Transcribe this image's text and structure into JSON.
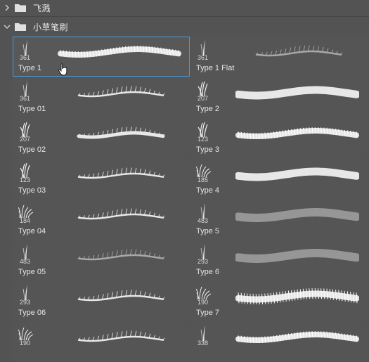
{
  "groups": [
    {
      "label": "飞溅",
      "expanded": false
    },
    {
      "label": "小草笔刷",
      "expanded": true
    }
  ],
  "brushes": [
    {
      "size": "361",
      "name": "Type 1",
      "stroke": "band",
      "tip": "blade",
      "selected": true
    },
    {
      "size": "361",
      "name": "Type 1 Flat",
      "stroke": "faint",
      "tip": "blade",
      "selected": false
    },
    {
      "size": "361",
      "name": "Type 01",
      "stroke": "spiky",
      "tip": "blade",
      "selected": false
    },
    {
      "size": "207",
      "name": "Type 2",
      "stroke": "thick",
      "tip": "tuft",
      "selected": false
    },
    {
      "size": "207",
      "name": "Type 02",
      "stroke": "sweep",
      "tip": "tuft",
      "selected": false
    },
    {
      "size": "123",
      "name": "Type 3",
      "stroke": "band",
      "tip": "tuft",
      "selected": false
    },
    {
      "size": "123",
      "name": "Type 03",
      "stroke": "spiky",
      "tip": "tuft",
      "selected": false
    },
    {
      "size": "185",
      "name": "Type 4",
      "stroke": "thick",
      "tip": "clump",
      "selected": false
    },
    {
      "size": "184",
      "name": "Type 04",
      "stroke": "spiky",
      "tip": "clump",
      "selected": false
    },
    {
      "size": "483",
      "name": "Type 5",
      "stroke": "soft",
      "tip": "blade",
      "selected": false
    },
    {
      "size": "483",
      "name": "Type 05",
      "stroke": "faint",
      "tip": "blade",
      "selected": false
    },
    {
      "size": "293",
      "name": "Type 6",
      "stroke": "soft",
      "tip": "blade",
      "selected": false
    },
    {
      "size": "293",
      "name": "Type 06",
      "stroke": "spiky",
      "tip": "blade",
      "selected": false
    },
    {
      "size": "190",
      "name": "Type 7",
      "stroke": "fringe",
      "tip": "clump",
      "selected": false
    },
    {
      "size": "190",
      "name": "",
      "stroke": "spiky",
      "tip": "clump",
      "selected": false
    },
    {
      "size": "338",
      "name": "",
      "stroke": "band",
      "tip": "blade",
      "selected": false
    }
  ],
  "colors": {
    "selection": "#4a9ad8",
    "panel": "#535353",
    "cell": "#555555"
  }
}
